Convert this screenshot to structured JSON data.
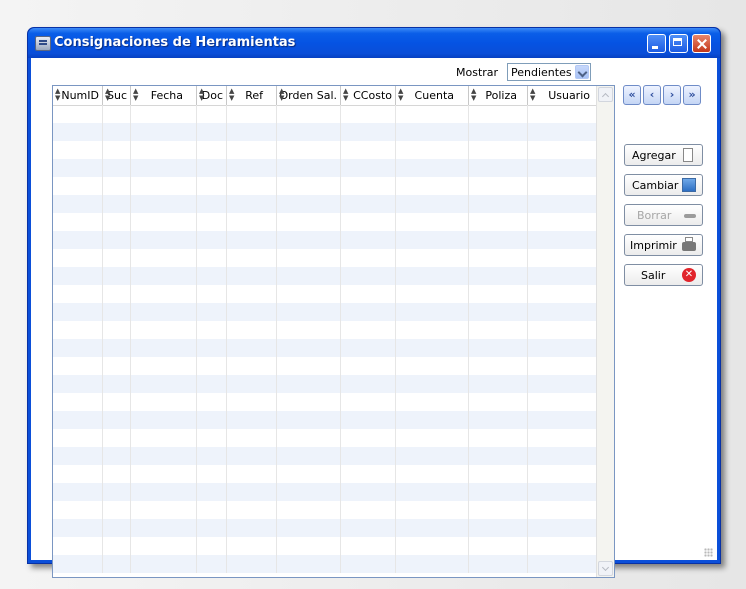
{
  "window": {
    "title": "Consignaciones de Herramientas",
    "title_icon": "app-window-icon",
    "controls": [
      "minimize-icon",
      "maximize-icon",
      "close-icon"
    ]
  },
  "filter": {
    "label": "Mostrar",
    "selected": "Pendientes"
  },
  "grid": {
    "columns": [
      "NumID",
      "Suc",
      "Fecha",
      "Doc",
      "Ref",
      "Orden Sal.",
      "CCosto",
      "Cuenta",
      "Poliza",
      "Usuario"
    ],
    "rows": []
  },
  "navigation": {
    "first": "«",
    "prev": "‹",
    "next": "›",
    "last": "»"
  },
  "actions": {
    "agregar": "Agregar",
    "cambiar": "Cambiar",
    "borrar": "Borrar",
    "imprimir": "Imprimir",
    "salir": "Salir"
  },
  "colors": {
    "title_bar": "#0553e3",
    "row_alt": "#eef3fb",
    "disabled_text": "#a6a6a6"
  }
}
